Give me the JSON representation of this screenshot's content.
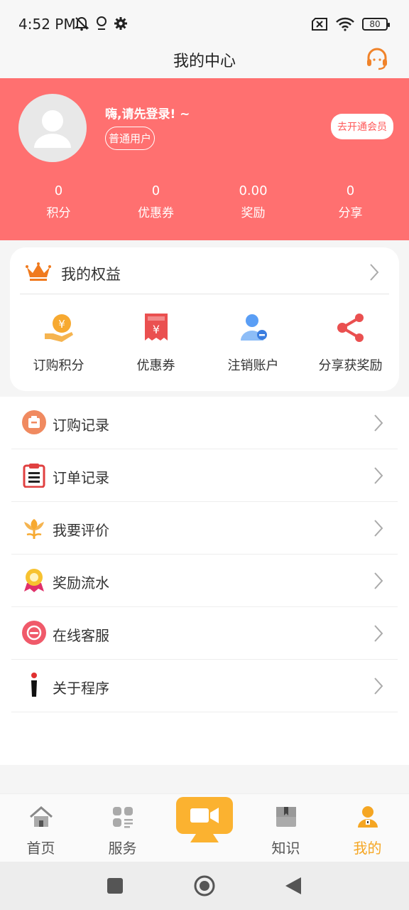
{
  "status": {
    "time": "4:52 PM",
    "battery": "80",
    "icons": [
      "mute-bell-icon",
      "location-icon",
      "settings-icon",
      "sim-off-icon",
      "wifi-icon",
      "battery-icon"
    ]
  },
  "header": {
    "title": "我的中心",
    "icon": "headset-icon"
  },
  "profile": {
    "greeting": "嗨,请先登录! ~",
    "user_type": "普通用户",
    "vip_button": "去开通会员",
    "stats": [
      {
        "value": "0",
        "label": "积分"
      },
      {
        "value": "0",
        "label": "优惠券"
      },
      {
        "value": "0.00",
        "label": "奖励"
      },
      {
        "value": "0",
        "label": "分享"
      }
    ]
  },
  "benefits": {
    "title": "我的权益",
    "items": [
      {
        "label": "订购积分",
        "icon": "points-hand-icon"
      },
      {
        "label": "优惠券",
        "icon": "coupon-icon"
      },
      {
        "label": "注销账户",
        "icon": "user-remove-icon"
      },
      {
        "label": "分享获奖励",
        "icon": "share-icon"
      }
    ]
  },
  "menu": {
    "items": [
      {
        "label": "订购记录",
        "icon": "bag-icon"
      },
      {
        "label": "订单记录",
        "icon": "clipboard-icon"
      },
      {
        "label": "我要评价",
        "icon": "flower-icon"
      },
      {
        "label": "奖励流水",
        "icon": "medal-icon"
      },
      {
        "label": "在线客服",
        "icon": "service-icon"
      },
      {
        "label": "关于程序",
        "icon": "info-icon"
      }
    ]
  },
  "tabbar": {
    "items": [
      {
        "label": "首页",
        "icon": "home-icon"
      },
      {
        "label": "服务",
        "icon": "grid-icon"
      },
      {
        "label": "",
        "icon": "video-camera-icon"
      },
      {
        "label": "知识",
        "icon": "book-icon"
      },
      {
        "label": "我的",
        "icon": "person-icon"
      }
    ],
    "active_color": "#f5a623"
  },
  "colors": {
    "profile_bg": "#ff7070",
    "accent": "#f5a623"
  }
}
